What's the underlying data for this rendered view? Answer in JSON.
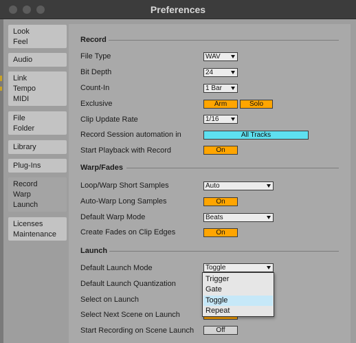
{
  "window": {
    "title": "Preferences"
  },
  "sidebar": {
    "tabs": [
      {
        "lines": [
          "Look",
          "Feel"
        ]
      },
      {
        "lines": [
          "Audio"
        ]
      },
      {
        "lines": [
          "Link",
          "Tempo",
          "MIDI"
        ]
      },
      {
        "lines": [
          "File",
          "Folder"
        ]
      },
      {
        "lines": [
          "Library"
        ]
      },
      {
        "lines": [
          "Plug-Ins"
        ]
      },
      {
        "lines": [
          "Record",
          "Warp",
          "Launch"
        ],
        "active": true
      },
      {
        "lines": [
          "Licenses",
          "Maintenance"
        ]
      }
    ]
  },
  "record": {
    "heading": "Record",
    "file_type": {
      "label": "File Type",
      "value": "WAV"
    },
    "bit_depth": {
      "label": "Bit Depth",
      "value": "24"
    },
    "count_in": {
      "label": "Count-In",
      "value": "1 Bar"
    },
    "exclusive": {
      "label": "Exclusive",
      "arm": "Arm",
      "solo": "Solo"
    },
    "clip_update_rate": {
      "label": "Clip Update Rate",
      "value": "1/16"
    },
    "record_session_automation": {
      "label": "Record Session automation in",
      "value": "All Tracks"
    },
    "start_playback": {
      "label": "Start Playback with Record",
      "value": "On"
    }
  },
  "warp": {
    "heading": "Warp/Fades",
    "loop_warp": {
      "label": "Loop/Warp Short Samples",
      "value": "Auto"
    },
    "auto_warp": {
      "label": "Auto-Warp Long Samples",
      "value": "On"
    },
    "default_warp_mode": {
      "label": "Default Warp Mode",
      "value": "Beats"
    },
    "create_fades": {
      "label": "Create Fades on Clip Edges",
      "value": "On"
    }
  },
  "launch": {
    "heading": "Launch",
    "default_launch_mode": {
      "label": "Default Launch Mode",
      "value": "Toggle"
    },
    "default_launch_quantization": {
      "label": "Default Launch Quantization"
    },
    "select_on_launch": {
      "label": "Select on Launch"
    },
    "select_next_scene": {
      "label": "Select Next Scene on Launch",
      "value": "On"
    },
    "start_recording": {
      "label": "Start Recording on Scene Launch",
      "value": "Off"
    },
    "menu_options": [
      "Trigger",
      "Gate",
      "Toggle",
      "Repeat"
    ],
    "menu_selected": "Toggle"
  },
  "colors": {
    "accent_orange": "#ffa500",
    "accent_cyan": "#5ee0f0",
    "menu_highlight": "#c6e8f8"
  }
}
